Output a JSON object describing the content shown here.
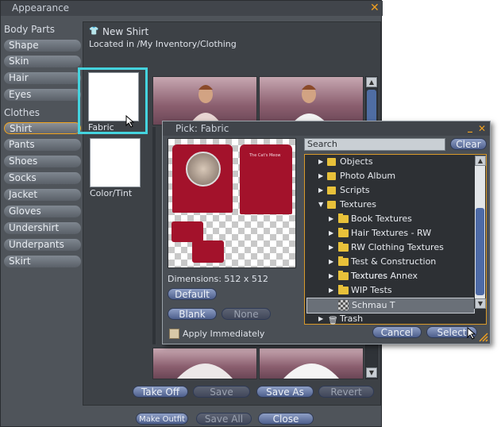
{
  "window": {
    "title": "Appearance"
  },
  "sidebar": {
    "body_parts_heading": "Body Parts",
    "body_parts": [
      "Shape",
      "Skin",
      "Hair",
      "Eyes"
    ],
    "clothes_heading": "Clothes",
    "clothes": [
      "Shirt",
      "Pants",
      "Shoes",
      "Socks",
      "Jacket",
      "Gloves",
      "Undershirt",
      "Underpants",
      "Skirt"
    ],
    "selected": "Shirt"
  },
  "item": {
    "name": "New Shirt",
    "location": "Located in /My Inventory/Clothing"
  },
  "swatches": {
    "fabric_label": "Fabric",
    "color_label": "Color/Tint"
  },
  "footer": {
    "take_off": "Take Off",
    "save": "Save",
    "save_as": "Save As",
    "revert": "Revert",
    "make_outfit": "Make Outfit",
    "save_all": "Save All",
    "close": "Close"
  },
  "picker": {
    "title": "Pick: Fabric",
    "search_label": "Search",
    "clear_label": "Clear",
    "dimensions": "Dimensions: 512 x 512",
    "default_label": "Default",
    "blank_label": "Blank",
    "none_label": "None",
    "apply_label": "Apply Immediately",
    "cancel_label": "Cancel",
    "select_label": "Select",
    "texture_text": "The Cat's Meow",
    "tree": [
      {
        "label": "Objects",
        "level": 1,
        "expanded": false
      },
      {
        "label": "Photo Album",
        "level": 1,
        "expanded": false
      },
      {
        "label": "Scripts",
        "level": 1,
        "expanded": false
      },
      {
        "label": "Textures",
        "level": 1,
        "expanded": true
      },
      {
        "label": "Book Textures",
        "level": 2,
        "expanded": false
      },
      {
        "label": "Hair Textures - RW",
        "level": 2,
        "expanded": false
      },
      {
        "label": "RW Clothing Textures",
        "level": 2,
        "expanded": false
      },
      {
        "label": "Test & Construction Textures",
        "level": 2,
        "expanded": false
      },
      {
        "label": "Textures Annex",
        "level": 2,
        "expanded": false
      },
      {
        "label": "WIP Tests",
        "level": 2,
        "expanded": false
      },
      {
        "label": "Schmau T",
        "level": 2,
        "selected": true
      },
      {
        "label": "Trash",
        "level": 1,
        "expanded": false
      }
    ]
  },
  "colors": {
    "accent": "#f0a020",
    "highlight": "#44d3de",
    "shirt": "#a3122b",
    "button": "#5f72a3"
  }
}
